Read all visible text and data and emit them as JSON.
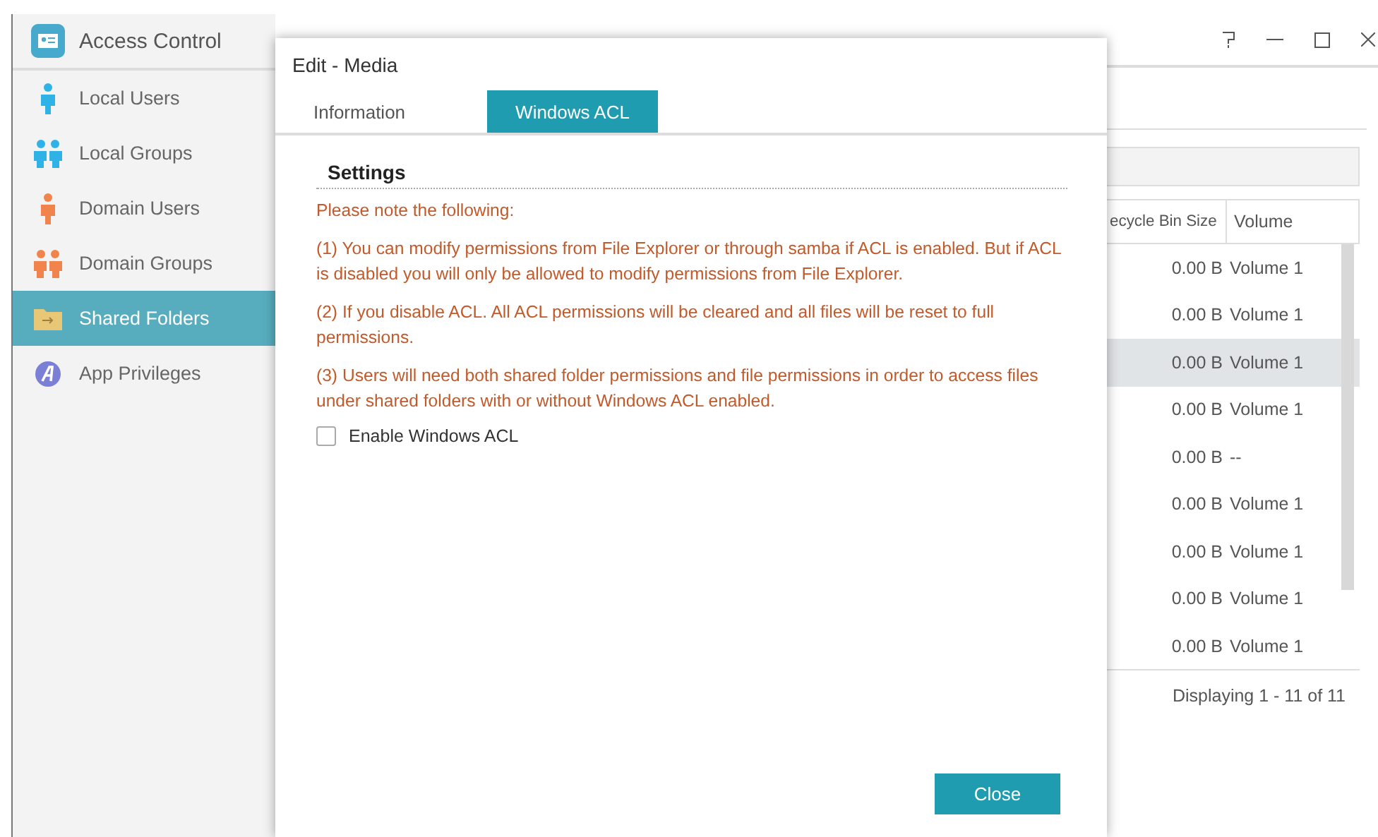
{
  "window": {
    "title": "Access Control"
  },
  "sidebar": {
    "items": [
      {
        "label": "Local Users",
        "kind": "local-user",
        "selected": false
      },
      {
        "label": "Local Groups",
        "kind": "local-group",
        "selected": false
      },
      {
        "label": "Domain Users",
        "kind": "domain-user",
        "selected": false
      },
      {
        "label": "Domain Groups",
        "kind": "domain-group",
        "selected": false
      },
      {
        "label": "Shared Folders",
        "kind": "folder",
        "selected": true
      },
      {
        "label": "App Privileges",
        "kind": "app",
        "selected": false
      }
    ]
  },
  "table": {
    "columns": [
      "ecycle Bin Size",
      "Volume"
    ],
    "rows": [
      {
        "cells": [
          "0.00 B",
          "Volume 1"
        ],
        "selected": false
      },
      {
        "cells": [
          "0.00 B",
          "Volume 1"
        ],
        "selected": false
      },
      {
        "cells": [
          "0.00 B",
          "Volume 1"
        ],
        "selected": true
      },
      {
        "cells": [
          "0.00 B",
          "Volume 1"
        ],
        "selected": false
      },
      {
        "cells": [
          "0.00 B",
          "--"
        ],
        "selected": false
      },
      {
        "cells": [
          "0.00 B",
          "Volume 1"
        ],
        "selected": false
      },
      {
        "cells": [
          "0.00 B",
          "Volume 1"
        ],
        "selected": false
      },
      {
        "cells": [
          "0.00 B",
          "Volume 1"
        ],
        "selected": false
      },
      {
        "cells": [
          "0.00 B",
          "Volume 1"
        ],
        "selected": false
      }
    ],
    "footer": "Displaying 1 - 11 of 11"
  },
  "dialog": {
    "title": "Edit - Media",
    "tabs": [
      {
        "label": "Information",
        "selected": false
      },
      {
        "label": "Windows ACL",
        "selected": true
      }
    ],
    "section_title": "Settings",
    "notes": [
      "Please note the following:",
      "(1) You can modify permissions from File Explorer or through samba if ACL is enabled. But if ACL is disabled you will only be allowed to modify permissions from File Explorer.",
      "(2) If you disable ACL. All ACL permissions will be cleared and all files will be reset to full permissions.",
      "(3) Users will need both shared folder permissions and file permissions in order to access files under shared folders with or without Windows ACL enabled."
    ],
    "checkbox": {
      "label": "Enable Windows ACL",
      "checked": false
    },
    "button": "Close"
  }
}
